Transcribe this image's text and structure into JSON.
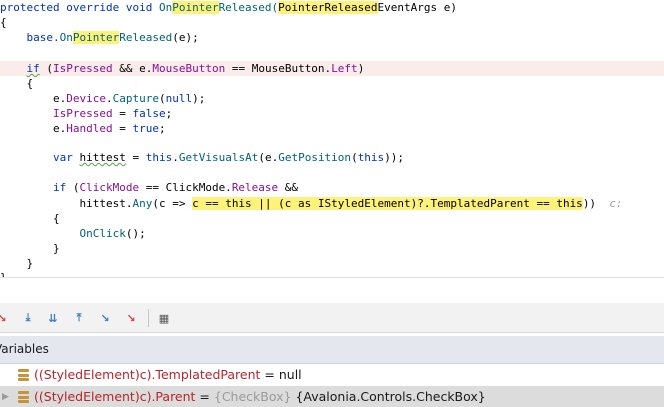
{
  "code": {
    "line1": [
      {
        "t": "protected override void ",
        "c": "kw"
      },
      {
        "t": "On",
        "c": "fn"
      },
      {
        "t": "Pointer",
        "c": "fn yellow"
      },
      {
        "t": "Released(",
        "c": "fn"
      },
      {
        "t": "PointerReleased",
        "c": "plain yellow"
      },
      {
        "t": "EventArgs e)",
        "c": "plain"
      }
    ],
    "line2": "{",
    "line3": [
      {
        "t": "    base.",
        "c": "kw"
      },
      {
        "t": "On",
        "c": "fn"
      },
      {
        "t": "Pointer",
        "c": "fn yellow"
      },
      {
        "t": "Released",
        "c": "fn"
      },
      {
        "t": "(e);",
        "c": "plain"
      }
    ],
    "line5": [
      {
        "t": "    ",
        "c": "plain"
      },
      {
        "t": "if",
        "c": "kw under"
      },
      {
        "t": " (",
        "c": "plain"
      },
      {
        "t": "IsPressed",
        "c": "mem"
      },
      {
        "t": " && e.",
        "c": "plain"
      },
      {
        "t": "MouseButton",
        "c": "mem"
      },
      {
        "t": " == MouseButton.",
        "c": "plain"
      },
      {
        "t": "Left",
        "c": "mem"
      },
      {
        "t": ")",
        "c": "plain"
      }
    ],
    "line6": "    {",
    "line7": [
      {
        "t": "        e.",
        "c": "plain"
      },
      {
        "t": "Device",
        "c": "mem"
      },
      {
        "t": ".",
        "c": "plain"
      },
      {
        "t": "Capture",
        "c": "fn"
      },
      {
        "t": "(",
        "c": "plain"
      },
      {
        "t": "null",
        "c": "kw"
      },
      {
        "t": ");",
        "c": "plain"
      }
    ],
    "line8": [
      {
        "t": "        ",
        "c": "plain"
      },
      {
        "t": "IsPressed",
        "c": "mem"
      },
      {
        "t": " = ",
        "c": "plain"
      },
      {
        "t": "false",
        "c": "kw"
      },
      {
        "t": ";",
        "c": "plain"
      }
    ],
    "line9": [
      {
        "t": "        e.",
        "c": "plain"
      },
      {
        "t": "Handled",
        "c": "mem"
      },
      {
        "t": " = ",
        "c": "plain"
      },
      {
        "t": "true",
        "c": "kw"
      },
      {
        "t": ";",
        "c": "plain"
      }
    ],
    "line11": [
      {
        "t": "        ",
        "c": "plain"
      },
      {
        "t": "var",
        "c": "kw"
      },
      {
        "t": " ",
        "c": "plain"
      },
      {
        "t": "hittest",
        "c": "plain under"
      },
      {
        "t": " = ",
        "c": "plain"
      },
      {
        "t": "this",
        "c": "kw"
      },
      {
        "t": ".",
        "c": "plain"
      },
      {
        "t": "GetVisualsAt",
        "c": "fn"
      },
      {
        "t": "(e.",
        "c": "plain"
      },
      {
        "t": "GetPosition",
        "c": "fn"
      },
      {
        "t": "(",
        "c": "plain"
      },
      {
        "t": "this",
        "c": "kw"
      },
      {
        "t": "));",
        "c": "plain"
      }
    ],
    "line13": [
      {
        "t": "        ",
        "c": "plain"
      },
      {
        "t": "if",
        "c": "kw"
      },
      {
        "t": " (",
        "c": "plain"
      },
      {
        "t": "ClickMode",
        "c": "mem"
      },
      {
        "t": " == ClickMode.",
        "c": "plain"
      },
      {
        "t": "Release",
        "c": "mem"
      },
      {
        "t": " &&",
        "c": "plain"
      }
    ],
    "line14": [
      {
        "t": "            hittest.",
        "c": "plain"
      },
      {
        "t": "Any",
        "c": "fn"
      },
      {
        "t": "(c => ",
        "c": "plain"
      },
      {
        "t": "c == this || (c as IStyledElement)?.TemplatedParent == this",
        "c": "plain yellow"
      },
      {
        "t": "))  ",
        "c": "plain"
      },
      {
        "t": "c:",
        "c": "hint"
      }
    ],
    "line15": "        {",
    "line16": [
      {
        "t": "            ",
        "c": "plain"
      },
      {
        "t": "OnClick",
        "c": "fn"
      },
      {
        "t": "();",
        "c": "plain"
      }
    ],
    "line17": "        }",
    "line18": "    }",
    "line19": "}"
  },
  "toolbar": {
    "buttons": [
      {
        "name": "step-over-icon",
        "glyph": "↘",
        "color": "#d9414b"
      },
      {
        "name": "step-into-icon",
        "glyph": "⤓",
        "color": "#3d7ebf"
      },
      {
        "name": "force-step-into-icon",
        "glyph": "⇊",
        "color": "#3d7ebf"
      },
      {
        "name": "step-out-icon",
        "glyph": "⤒",
        "color": "#3d7ebf"
      },
      {
        "name": "run-to-cursor-icon",
        "glyph": "↘",
        "color": "#3d7ebf"
      },
      {
        "name": "force-run-to-cursor-icon",
        "glyph": "↘",
        "color": "#d9414b"
      },
      {
        "name": "evaluate-expression-icon",
        "glyph": "▦",
        "color": "#555555"
      }
    ]
  },
  "panel": {
    "title": "Variables"
  },
  "variables": [
    {
      "name": "((StyledElement)c).TemplatedParent",
      "op": " = ",
      "type": "",
      "value": "null",
      "selected": false,
      "expandable": false
    },
    {
      "name": "((StyledElement)c).Parent",
      "op": " = ",
      "type": "{CheckBox} ",
      "value": "{Avalonia.Controls.CheckBox}",
      "selected": true,
      "expandable": true
    }
  ]
}
